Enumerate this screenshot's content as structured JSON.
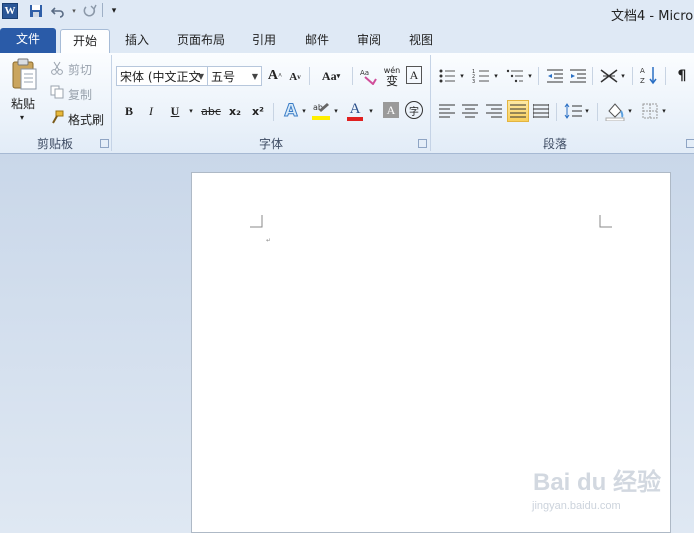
{
  "app": {
    "title": "文档4 - Micro"
  },
  "qat": {
    "icons": [
      "word-icon",
      "save-icon",
      "undo-icon",
      "redo-icon",
      "customize-icon"
    ]
  },
  "tabs": {
    "file": "文件",
    "home": "开始",
    "insert": "插入",
    "layout": "页面布局",
    "references": "引用",
    "mailings": "邮件",
    "review": "审阅",
    "view": "视图"
  },
  "clipboard": {
    "paste": "粘贴",
    "cut": "剪切",
    "copy": "复制",
    "format_painter": "格式刷",
    "group": "剪贴板"
  },
  "font": {
    "font_name": "宋体 (中文正文",
    "font_size": "五号",
    "group": "字体",
    "grow": "A",
    "shrink": "A",
    "case": "Aa",
    "bold": "B",
    "italic": "I",
    "underline": "U",
    "strike": "abc",
    "subscript": "x₂",
    "superscript": "x²",
    "font_color_letter": "A",
    "char_shade": "A",
    "enclose": "字",
    "phonetic": "wén",
    "phonetic_char": "变"
  },
  "paragraph": {
    "group": "段落"
  },
  "watermark": {
    "main": "Bai du 经验",
    "sub": "jingyan.baidu.com"
  },
  "colors": {
    "accent": "#2a5ba8",
    "highlight_active": "#f8cf5b",
    "font_red": "#e02020"
  }
}
